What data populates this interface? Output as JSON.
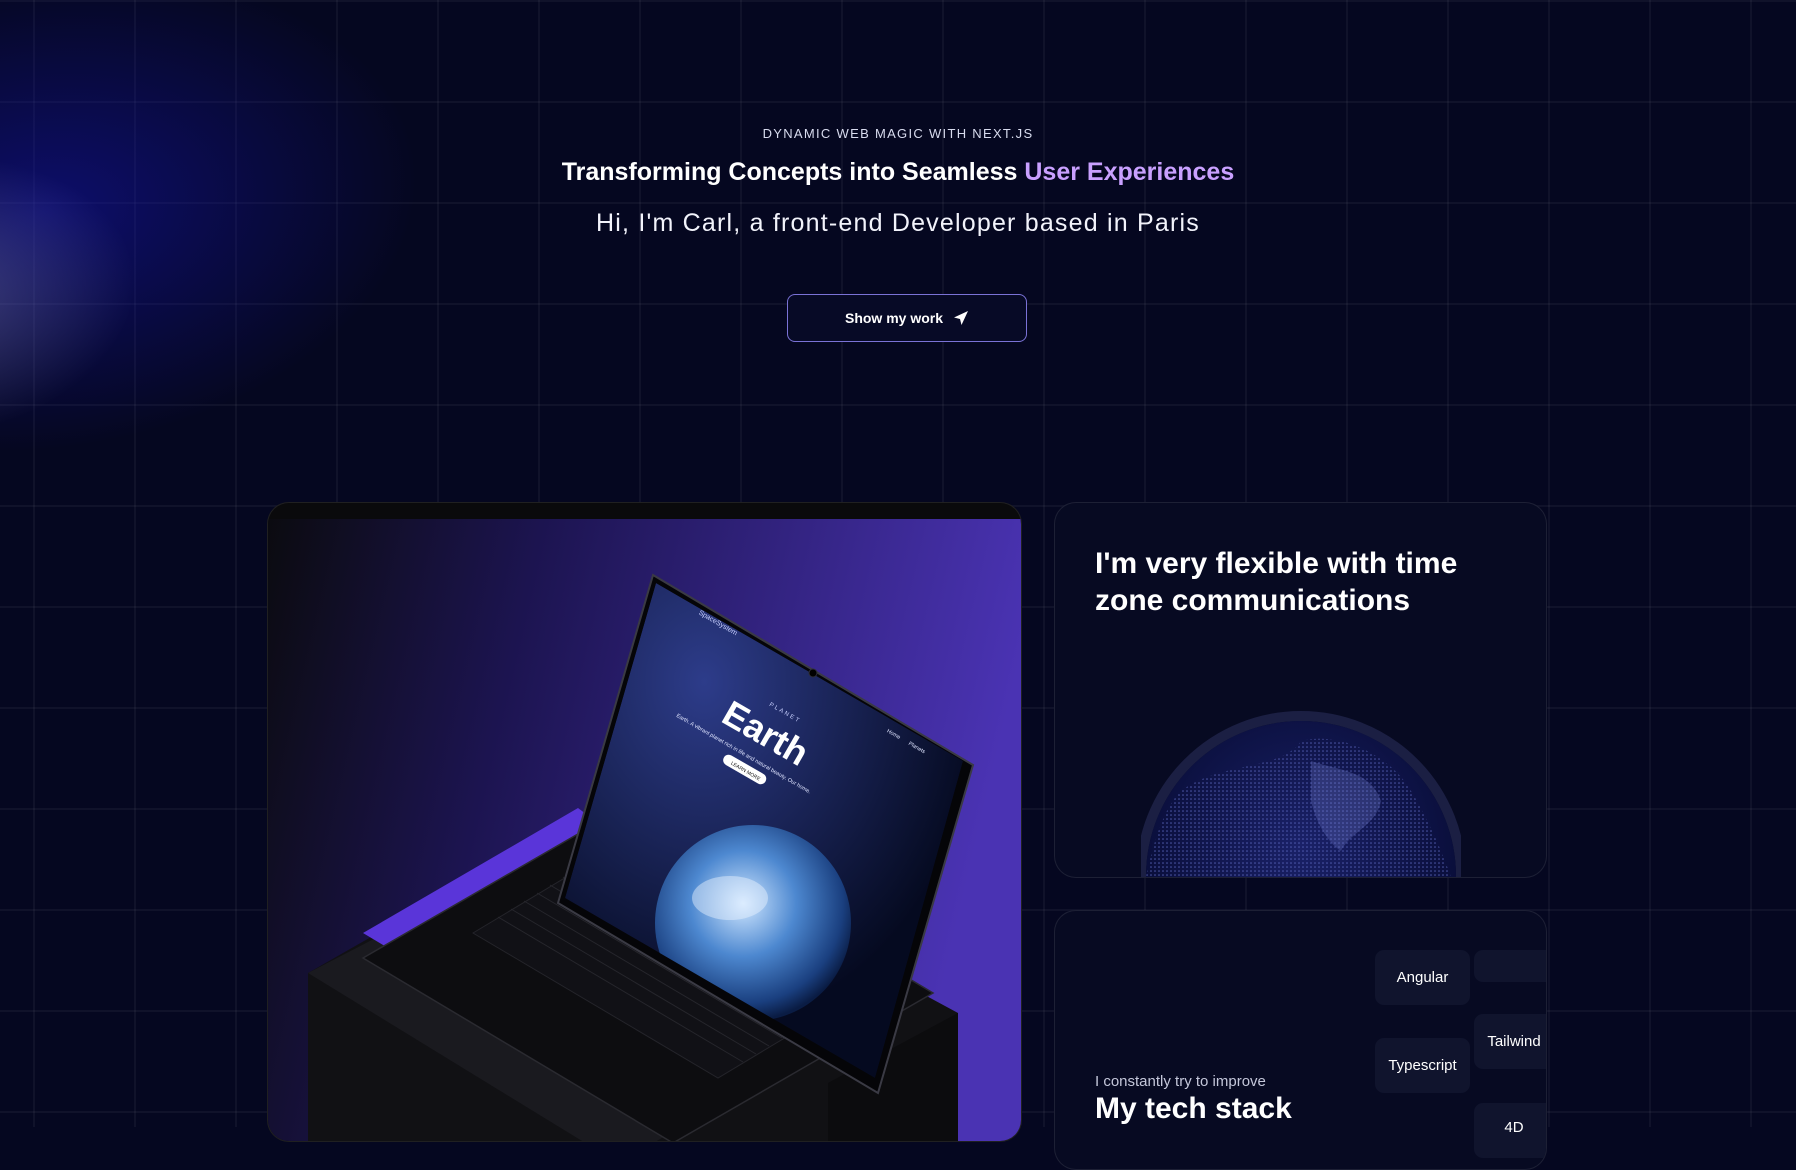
{
  "hero": {
    "eyebrow": "DYNAMIC WEB MAGIC WITH NEXT.JS",
    "headline_main": "Transforming Concepts into Seamless",
    "headline_accent": "User Experiences",
    "subline": "Hi, I'm Carl, a front-end Developer based in Paris",
    "cta_label": "Show my work",
    "cta_icon": "send-icon"
  },
  "mockup": {
    "brand": "SpaceSystem",
    "eyebrow": "PLANET",
    "title": "Earth",
    "tagline": "Earth. A vibrant planet rich in life and natural beauty. Our home.",
    "button": "LEARN MORE",
    "nav": [
      "Home",
      "Planets"
    ]
  },
  "time_card": {
    "title": "I'm very flexible with time zone communications"
  },
  "stack_card": {
    "subtitle": "I constantly try to improve",
    "title": "My tech stack",
    "left_column": [
      "Angular",
      "Typescript"
    ],
    "right_column": [
      "",
      "Tailwind",
      "4D"
    ]
  },
  "colors": {
    "background": "#050720",
    "accent": "#c9a0ff",
    "button_border": "#7a72d6",
    "laptop_glow": "#5a35d9"
  }
}
